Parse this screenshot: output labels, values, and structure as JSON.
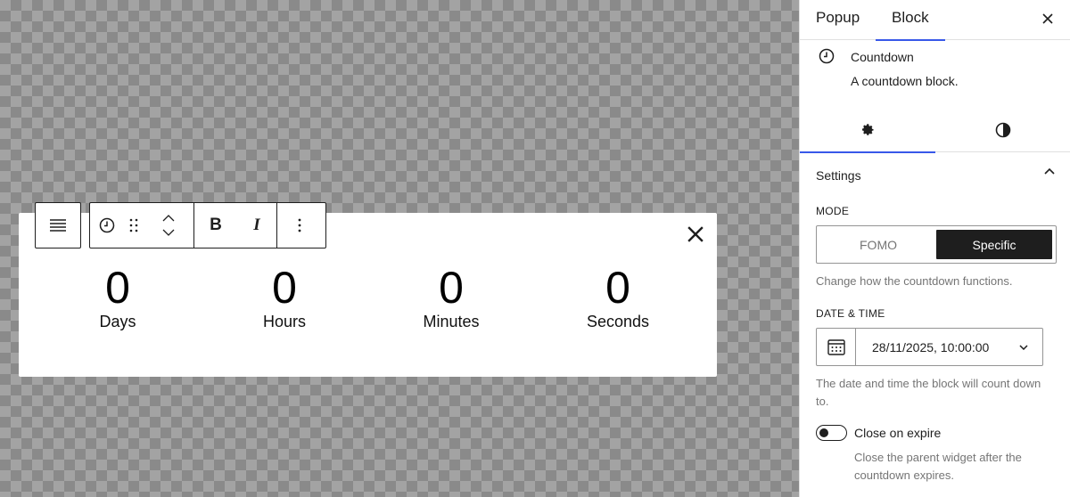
{
  "colors": {
    "accent": "#3858e9",
    "dark": "#1e1e1e",
    "muted": "#757575"
  },
  "canvas": {
    "countdown": [
      {
        "value": "0",
        "label": "Days"
      },
      {
        "value": "0",
        "label": "Hours"
      },
      {
        "value": "0",
        "label": "Minutes"
      },
      {
        "value": "0",
        "label": "Seconds"
      }
    ],
    "toolbar": {
      "bold_label": "B",
      "italic_label": "I",
      "icons": [
        "align-justify-icon",
        "clock-icon",
        "drag-handle-icon",
        "chevron-up-icon",
        "chevron-down-icon",
        "more-vertical-icon"
      ]
    },
    "close_icon": "close-icon"
  },
  "sidebar": {
    "tabs": [
      {
        "label": "Popup",
        "active": false
      },
      {
        "label": "Block",
        "active": true
      }
    ],
    "block": {
      "title": "Countdown",
      "description": "A countdown block."
    },
    "subtabs": [
      "gear-icon",
      "contrast-icon"
    ],
    "panel": {
      "title": "Settings",
      "mode_label": "MODE",
      "mode_options": [
        "FOMO",
        "Specific"
      ],
      "mode_selected": "Specific",
      "mode_help": "Change how the countdown functions.",
      "datetime_label": "DATE & TIME",
      "datetime_value": "28/11/2025, 10:00:00",
      "datetime_help": "The date and time the block will count down to.",
      "close_on_expire_label": "Close on expire",
      "close_on_expire_help": "Close the parent widget after the countdown expires.",
      "close_on_expire": false
    }
  }
}
